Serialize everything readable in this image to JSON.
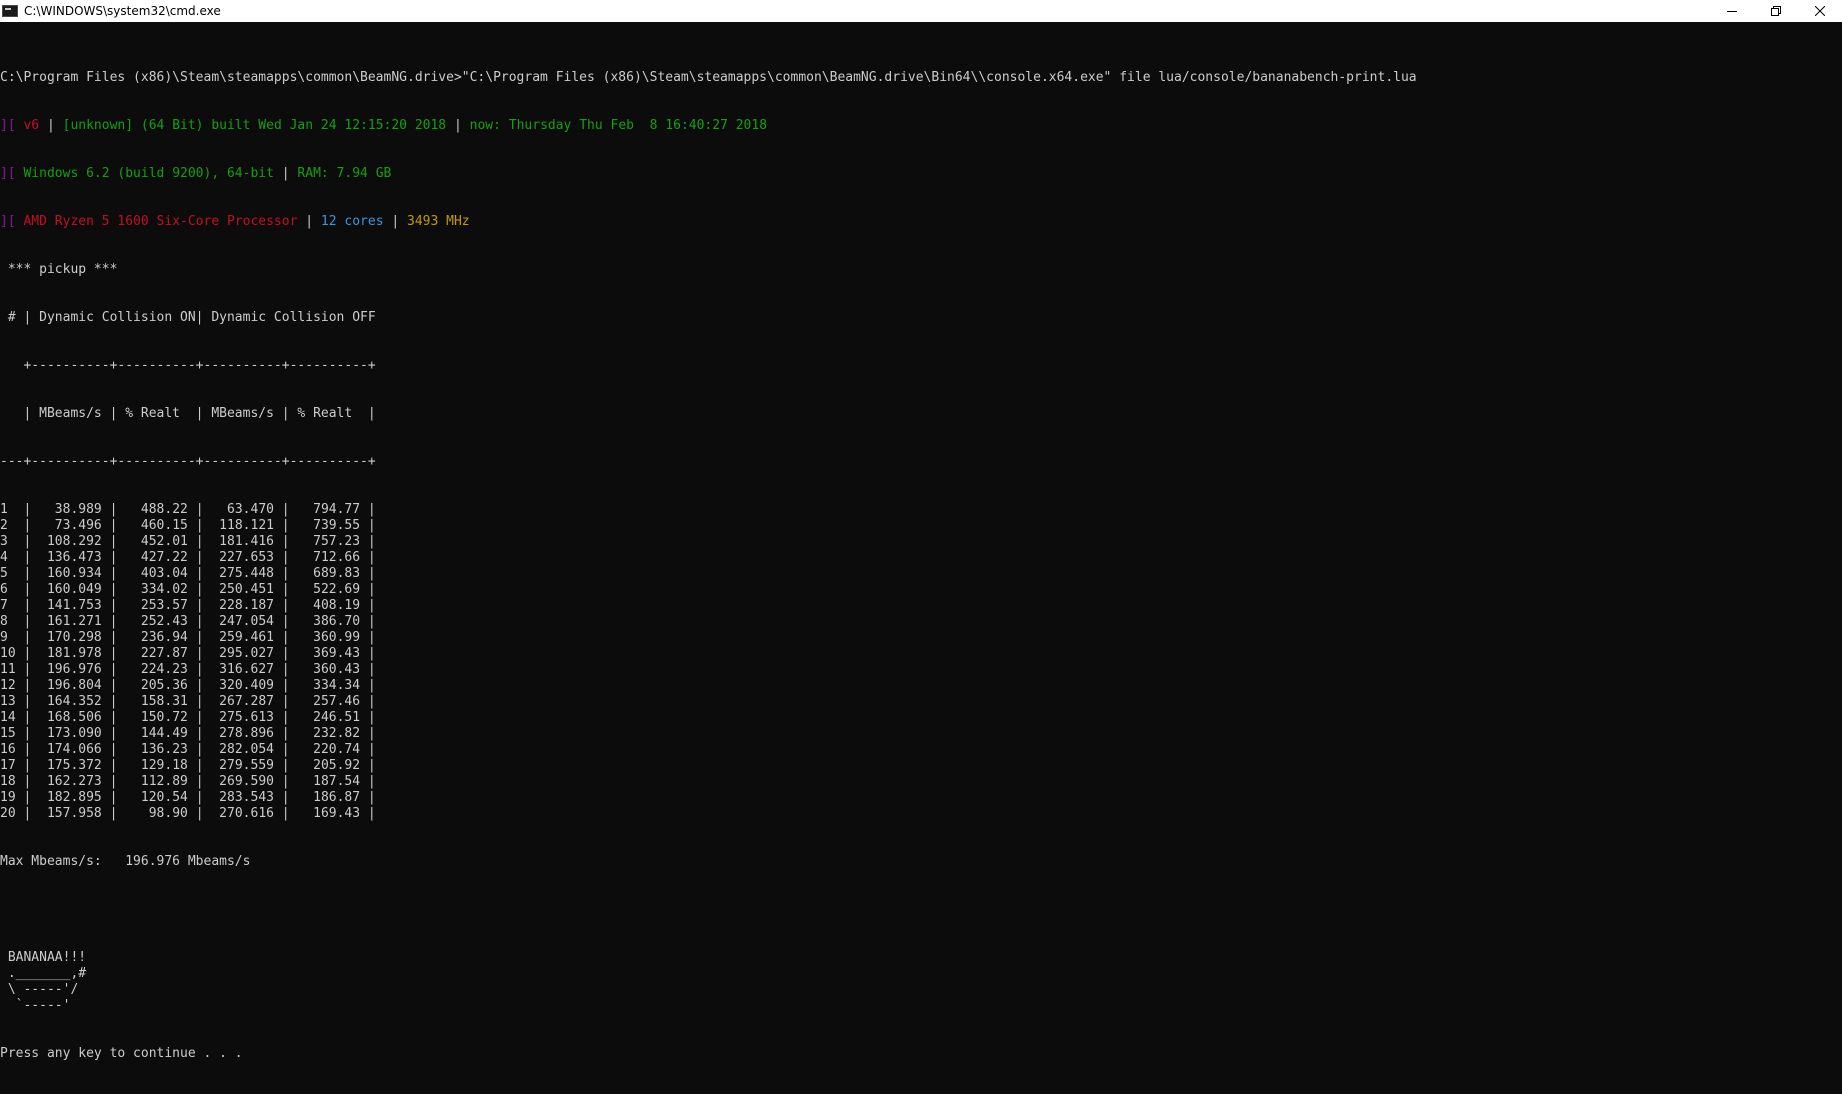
{
  "window": {
    "title": "C:\\WINDOWS\\system32\\cmd.exe",
    "icon": "cmd-app-icon",
    "controls": [
      "minimize-icon",
      "restore-icon",
      "close-icon"
    ]
  },
  "console": {
    "command_line": "C:\\Program Files (x86)\\Steam\\steamapps\\common\\BeamNG.drive>\"C:\\Program Files (x86)\\Steam\\steamapps\\common\\BeamNG.drive\\Bin64\\\\console.x64.exe\" file lua/console/bananabench-print.lua",
    "info1": {
      "prefix": "][",
      "version": " v6",
      "sep1": " | ",
      "build": "[unknown] (64 Bit) built Wed Jan 24 12:15:20 2018",
      "sep2": " | ",
      "now": "now: Thursday Thu Feb  8 16:40:27 2018"
    },
    "info2": {
      "prefix": "][",
      "os": " Windows 6.2 (build 9200), 64-bit",
      "sep": " | ",
      "ram": "RAM: 7.94 GB"
    },
    "info3": {
      "prefix": "][",
      "cpu": " AMD Ryzen 5 1600 Six-Core Processor",
      "sep1": " | ",
      "cores": "12 cores",
      "sep2": " | ",
      "mhz": "3493 MHz"
    },
    "vehicle_header": " *** pickup ***",
    "table_header_1": " # | Dynamic Collision ON| Dynamic Collision OFF",
    "table_border_1": "   +----------+----------+----------+----------+",
    "table_header_2": "   | MBeams/s | % Realt  | MBeams/s | % Realt  |",
    "table_border_2": "---+----------+----------+----------+----------+",
    "rows": [
      {
        "n": "1",
        "on_mbeams": "38.989",
        "on_realt": "488.22",
        "off_mbeams": "63.470",
        "off_realt": "794.77"
      },
      {
        "n": "2",
        "on_mbeams": "73.496",
        "on_realt": "460.15",
        "off_mbeams": "118.121",
        "off_realt": "739.55"
      },
      {
        "n": "3",
        "on_mbeams": "108.292",
        "on_realt": "452.01",
        "off_mbeams": "181.416",
        "off_realt": "757.23"
      },
      {
        "n": "4",
        "on_mbeams": "136.473",
        "on_realt": "427.22",
        "off_mbeams": "227.653",
        "off_realt": "712.66"
      },
      {
        "n": "5",
        "on_mbeams": "160.934",
        "on_realt": "403.04",
        "off_mbeams": "275.448",
        "off_realt": "689.83"
      },
      {
        "n": "6",
        "on_mbeams": "160.049",
        "on_realt": "334.02",
        "off_mbeams": "250.451",
        "off_realt": "522.69"
      },
      {
        "n": "7",
        "on_mbeams": "141.753",
        "on_realt": "253.57",
        "off_mbeams": "228.187",
        "off_realt": "408.19"
      },
      {
        "n": "8",
        "on_mbeams": "161.271",
        "on_realt": "252.43",
        "off_mbeams": "247.054",
        "off_realt": "386.70"
      },
      {
        "n": "9",
        "on_mbeams": "170.298",
        "on_realt": "236.94",
        "off_mbeams": "259.461",
        "off_realt": "360.99"
      },
      {
        "n": "10",
        "on_mbeams": "181.978",
        "on_realt": "227.87",
        "off_mbeams": "295.027",
        "off_realt": "369.43"
      },
      {
        "n": "11",
        "on_mbeams": "196.976",
        "on_realt": "224.23",
        "off_mbeams": "316.627",
        "off_realt": "360.43"
      },
      {
        "n": "12",
        "on_mbeams": "196.804",
        "on_realt": "205.36",
        "off_mbeams": "320.409",
        "off_realt": "334.34"
      },
      {
        "n": "13",
        "on_mbeams": "164.352",
        "on_realt": "158.31",
        "off_mbeams": "267.287",
        "off_realt": "257.46"
      },
      {
        "n": "14",
        "on_mbeams": "168.506",
        "on_realt": "150.72",
        "off_mbeams": "275.613",
        "off_realt": "246.51"
      },
      {
        "n": "15",
        "on_mbeams": "173.090",
        "on_realt": "144.49",
        "off_mbeams": "278.896",
        "off_realt": "232.82"
      },
      {
        "n": "16",
        "on_mbeams": "174.066",
        "on_realt": "136.23",
        "off_mbeams": "282.054",
        "off_realt": "220.74"
      },
      {
        "n": "17",
        "on_mbeams": "175.372",
        "on_realt": "129.18",
        "off_mbeams": "279.559",
        "off_realt": "205.92"
      },
      {
        "n": "18",
        "on_mbeams": "162.273",
        "on_realt": "112.89",
        "off_mbeams": "269.590",
        "off_realt": "187.54"
      },
      {
        "n": "19",
        "on_mbeams": "182.895",
        "on_realt": "120.54",
        "off_mbeams": "283.543",
        "off_realt": "186.87"
      },
      {
        "n": "20",
        "on_mbeams": "157.958",
        "on_realt": "98.90",
        "off_mbeams": "270.616",
        "off_realt": "169.43"
      }
    ],
    "max_line": "Max Mbeams/s:   196.976 Mbeams/s",
    "banana_art": [
      " BANANAA!!!",
      " ._______,#",
      " \\ -----'/",
      "  `-----'"
    ],
    "prompt": "Press any key to continue . . ."
  },
  "colors": {
    "background": "#0c0c0c",
    "text": "#cccccc",
    "magenta": "#881798",
    "red": "#c50f1f",
    "green": "#13a10e",
    "cyan": "#3a96dd",
    "yellow": "#c19c00",
    "gray": "#767676"
  }
}
